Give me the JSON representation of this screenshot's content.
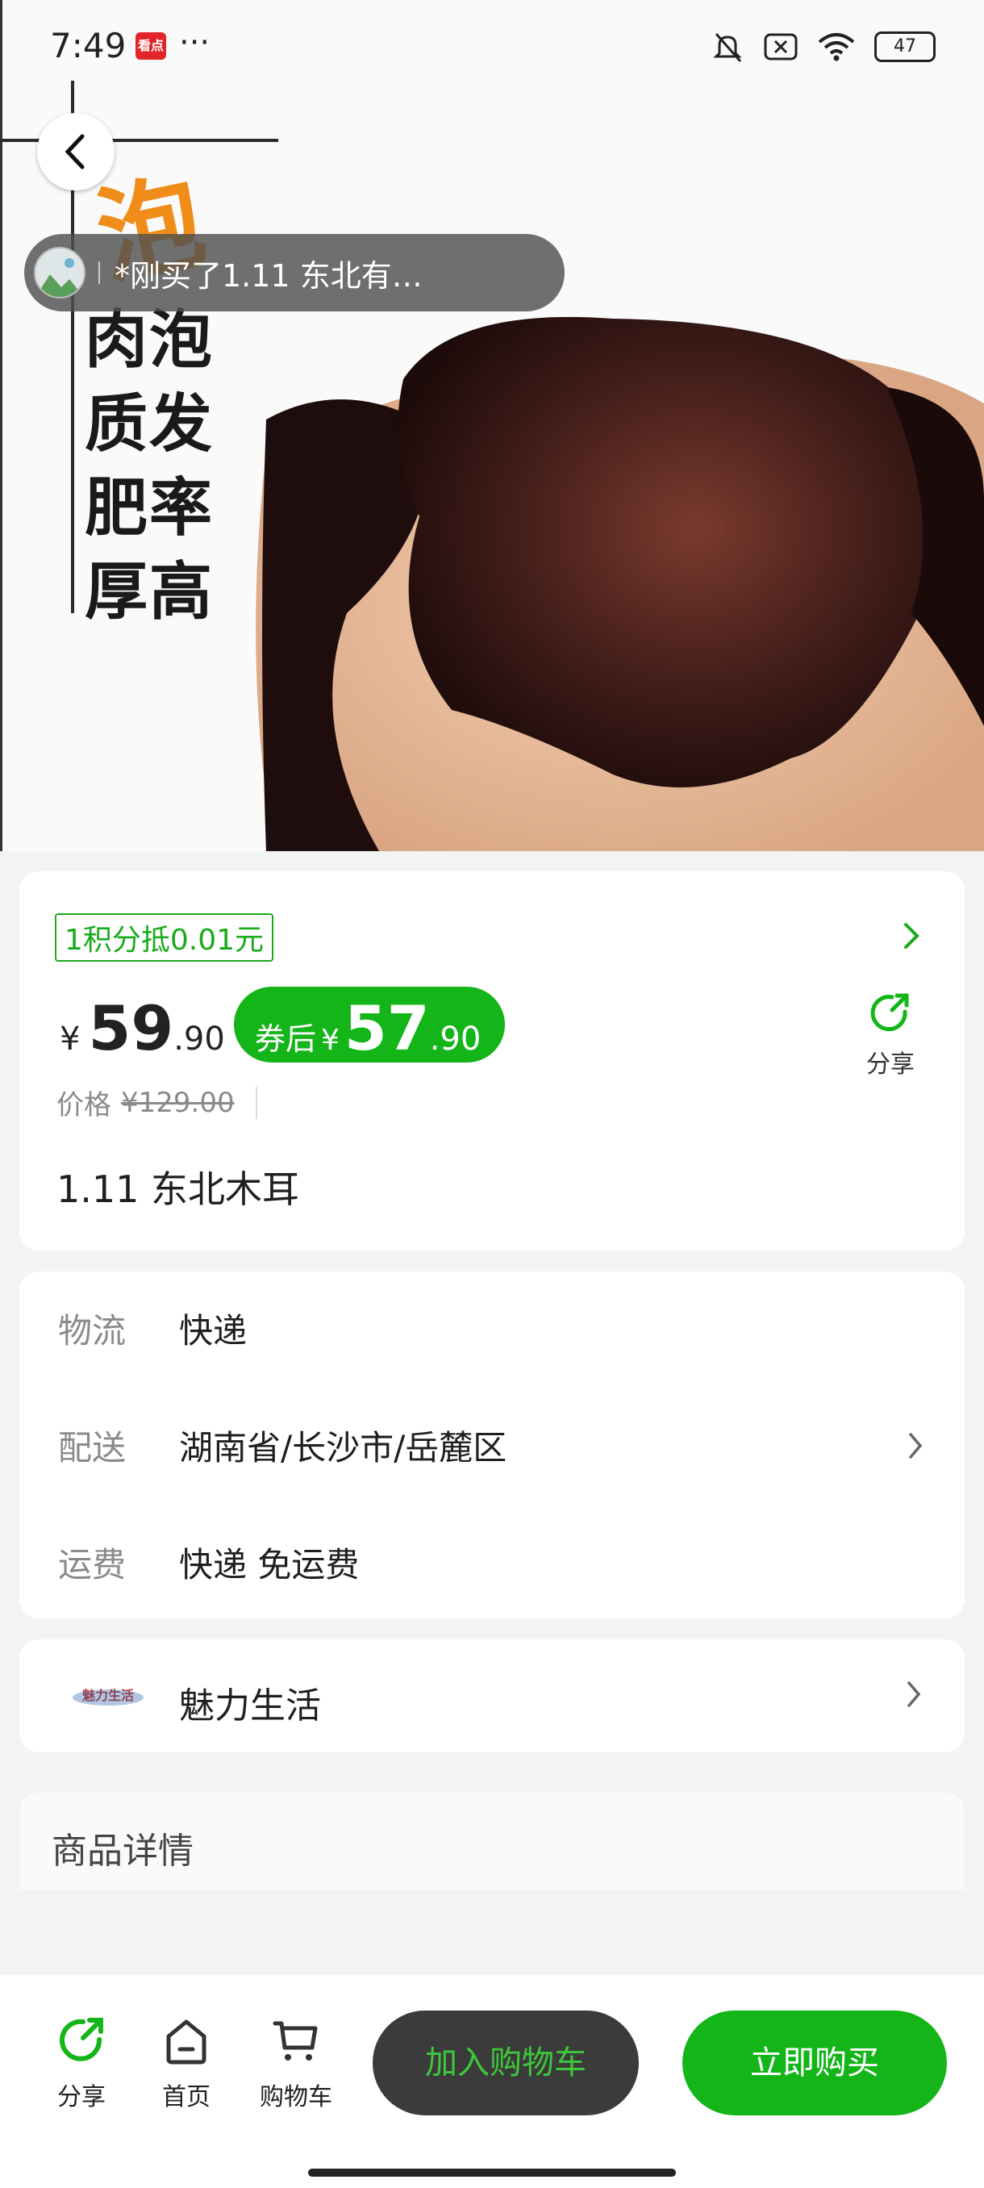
{
  "status_bar": {
    "time": "7:49",
    "app_badge": "看点",
    "more": "···",
    "battery": "47"
  },
  "hero": {
    "slogan_orange": "泡",
    "slogan_lines": [
      "肉泡",
      "质发",
      "肥率",
      "厚高"
    ],
    "ticker_text": "*刚买了1.11 东北有…"
  },
  "price_card": {
    "points_badge": "1积分抵0.01元",
    "currency": "¥",
    "price_int": "59",
    "price_dec": ".90",
    "coupon_label": "券后",
    "coupon_int": "57",
    "coupon_dec": ".90",
    "share_label": "分享",
    "orig_label": "价格",
    "orig_value": "¥129.00",
    "title": "1.11 东北木耳"
  },
  "info": {
    "logistics_key": "物流",
    "logistics_val": "快递",
    "delivery_key": "配送",
    "delivery_val": "湖南省/长沙市/岳麓区",
    "freight_key": "运费",
    "freight_val": "快递 免运费"
  },
  "store": {
    "logo_text": "魅力生活",
    "name": "魅力生活"
  },
  "detail": {
    "title": "商品详情"
  },
  "bottom_bar": {
    "share": "分享",
    "home": "首页",
    "cart": "购物车",
    "add_to_cart": "加入购物车",
    "buy_now": "立即购买"
  },
  "colors": {
    "accent_green": "#13b518",
    "dark_button": "#3b3b3b"
  }
}
